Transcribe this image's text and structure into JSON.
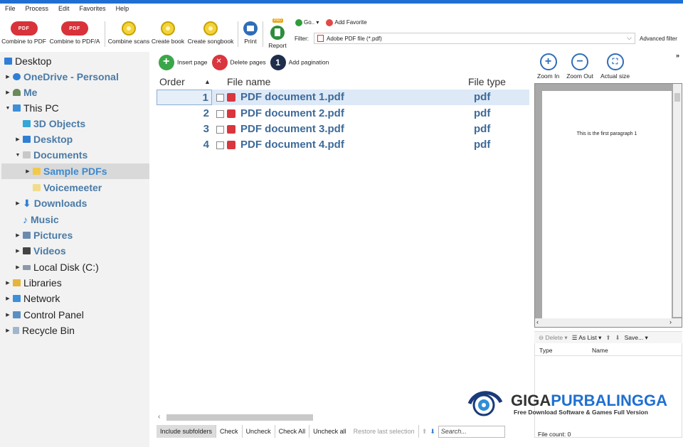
{
  "menu": [
    "File",
    "Process",
    "Edit",
    "Favorites",
    "Help"
  ],
  "toolbar": {
    "combine_pdf": "Combine to PDF",
    "combine_pdfa": "Combine to PDF/A",
    "combine_scans": "Combine scans",
    "create_book": "Create book",
    "create_songbook": "Create songbook",
    "print": "Print",
    "report": "Report",
    "pro_badge": "PRO",
    "go": "Go..",
    "add_favorite": "Add Favorite",
    "filter_label": "Filter:",
    "filter_value": "Adobe PDF file (*.pdf)",
    "advanced_filter": "Advanced filter",
    "pdf_icon_text": "PDF"
  },
  "tree": [
    {
      "label": "Desktop"
    },
    {
      "label": "OneDrive - Personal"
    },
    {
      "label": "Me"
    },
    {
      "label": "This PC"
    },
    {
      "label": "3D Objects"
    },
    {
      "label": "Desktop"
    },
    {
      "label": "Documents"
    },
    {
      "label": "Sample PDFs"
    },
    {
      "label": "Voicemeeter"
    },
    {
      "label": "Downloads"
    },
    {
      "label": "Music"
    },
    {
      "label": "Pictures"
    },
    {
      "label": "Videos"
    },
    {
      "label": "Local Disk (C:)"
    },
    {
      "label": "Libraries"
    },
    {
      "label": "Network"
    },
    {
      "label": "Control Panel"
    },
    {
      "label": "Recycle Bin"
    }
  ],
  "pages": {
    "insert": "Insert page",
    "delete": "Delete pages",
    "pagination": "Add pagination",
    "pagination_icon": "1"
  },
  "table": {
    "headers": {
      "order": "Order",
      "name": "File name",
      "type": "File type"
    },
    "rows": [
      {
        "order": "1",
        "name": "PDF document 1.pdf",
        "type": "pdf"
      },
      {
        "order": "2",
        "name": "PDF document 2.pdf",
        "type": "pdf"
      },
      {
        "order": "3",
        "name": "PDF document 3.pdf",
        "type": "pdf"
      },
      {
        "order": "4",
        "name": "PDF document 4.pdf",
        "type": "pdf"
      }
    ]
  },
  "bottom": {
    "include_subfolders": "Include subfolders",
    "check": "Check",
    "uncheck": "Uncheck",
    "check_all": "Check All",
    "uncheck_all": "Uncheck all",
    "restore": "Restore last selection",
    "search_placeholder": "Search..."
  },
  "preview": {
    "zoom_in": "Zoom In",
    "zoom_out": "Zoom Out",
    "actual_size": "Actual size",
    "page_text": "This is the first paragraph 1"
  },
  "list": {
    "delete": "Delete",
    "as_list": "As List",
    "save": "Save...",
    "col_type": "Type",
    "col_name": "Name",
    "file_count": "File count:  0"
  },
  "watermark": {
    "brand_part1": "GIGA",
    "brand_part2": "PURBALINGGA",
    "tagline": "Free Download Software & Games Full Version"
  },
  "colors": {
    "accent": "#1f6fd1",
    "folder_text": "#4a7aa6",
    "selected_bg": "#d9d9d9"
  }
}
